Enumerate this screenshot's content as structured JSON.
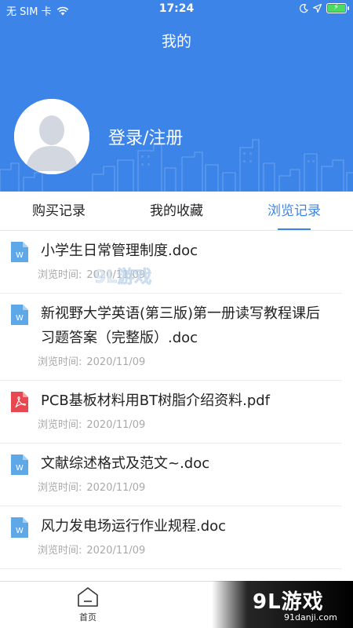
{
  "status_bar": {
    "carrier": "无 SIM 卡",
    "time": "17:24"
  },
  "header": {
    "title": "我的",
    "login_label": "登录/注册"
  },
  "tabs": [
    {
      "label": "购买记录",
      "active": false
    },
    {
      "label": "我的收藏",
      "active": false
    },
    {
      "label": "浏览记录",
      "active": true
    }
  ],
  "history": {
    "meta_label": "浏览时间:",
    "items": [
      {
        "title": "小学生日常管理制度.doc",
        "type": "word",
        "date": "2020/11/09"
      },
      {
        "title": "新视野大学英语(第三版)第一册读写教程课后习题答案（完整版）.doc",
        "type": "word",
        "date": "2020/11/09"
      },
      {
        "title": "PCB基板材料用BT树脂介绍资料.pdf",
        "type": "pdf",
        "date": "2020/11/09"
      },
      {
        "title": "文献综述格式及范文~.doc",
        "type": "word",
        "date": "2020/11/09"
      },
      {
        "title": "风力发电场运行作业规程.doc",
        "type": "word",
        "date": "2020/11/09"
      }
    ]
  },
  "bottom_nav": {
    "home_label": "首页"
  },
  "watermark": {
    "text": "9L游戏",
    "small_text": "9L游戏",
    "url": "91danji.com"
  },
  "colors": {
    "primary": "#3d84e8",
    "word_icon": "#5fa8e8",
    "pdf_icon": "#e8484f",
    "meta_text": "#a9a9a9"
  }
}
